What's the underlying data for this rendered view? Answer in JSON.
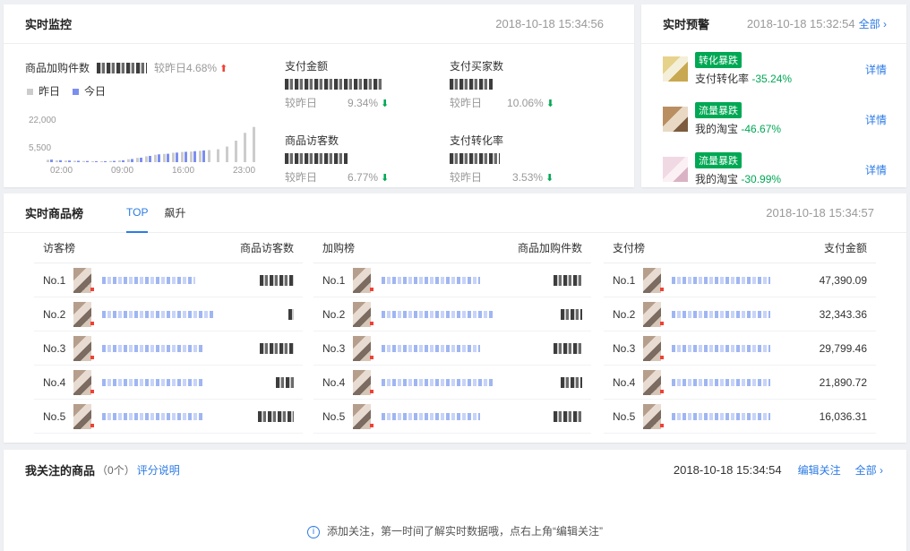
{
  "monitor": {
    "title": "实时监控",
    "time": "2018-10-18 15:34:56",
    "cart_label": "商品加购件数",
    "cart_cmp": "较昨日4.68%",
    "legend_yesterday": "昨日",
    "legend_today": "今日",
    "y_ticks": [
      "22,000",
      "5,500"
    ],
    "x_ticks": [
      "02:00",
      "09:00",
      "16:00",
      "23:00"
    ],
    "metrics": [
      {
        "label": "支付金额",
        "cmp_label": "较昨日",
        "cmp": "9.34%"
      },
      {
        "label": "支付买家数",
        "cmp_label": "较昨日",
        "cmp": "10.06%"
      },
      {
        "label": "商品访客数",
        "cmp_label": "较昨日",
        "cmp": "6.77%"
      },
      {
        "label": "支付转化率",
        "cmp_label": "较昨日",
        "cmp": "3.53%"
      }
    ],
    "colors": {
      "yesterday": "#cccccc",
      "today": "#7b8ef0"
    }
  },
  "chart_data": {
    "type": "bar",
    "categories": [
      "02:00",
      "09:00",
      "16:00",
      "23:00"
    ],
    "series": [
      {
        "name": "昨日",
        "values": [
          1200,
          900,
          800,
          700,
          600,
          500,
          500,
          600,
          900,
          1500,
          2200,
          3000,
          3800,
          4200,
          4800,
          5200,
          5400,
          5800,
          6200,
          6600,
          8000,
          11000,
          15000,
          18000
        ]
      },
      {
        "name": "今日",
        "values": [
          1300,
          1000,
          850,
          700,
          600,
          520,
          520,
          650,
          950,
          1600,
          2300,
          3200,
          4000,
          4300,
          4900,
          5300,
          5600,
          6000
        ]
      }
    ],
    "ylim": [
      0,
      22000
    ]
  },
  "alerts": {
    "title": "实时预警",
    "time": "2018-10-18 15:32:54",
    "all_link": "全部",
    "items": [
      {
        "badge": "转化暴跌",
        "label": "支付转化率",
        "change": "-35.24%",
        "link": "详情"
      },
      {
        "badge": "流量暴跌",
        "label": "我的淘宝",
        "change": "-46.67%",
        "link": "详情"
      },
      {
        "badge": "流量暴跌",
        "label": "我的淘宝",
        "change": "-30.99%",
        "link": "详情"
      }
    ]
  },
  "ranking": {
    "title": "实时商品榜",
    "tabs": [
      "TOP",
      "飙升"
    ],
    "time": "2018-10-18 15:34:57",
    "columns": [
      {
        "title": "访客榜",
        "value_header": "商品访客数"
      },
      {
        "title": "加购榜",
        "value_header": "商品加购件数"
      },
      {
        "title": "支付榜",
        "value_header": "支付金额"
      }
    ],
    "ranks": [
      "No.1",
      "No.2",
      "No.3",
      "No.4",
      "No.5"
    ],
    "pay_values": [
      "47,390.09",
      "32,343.36",
      "29,799.46",
      "21,890.72",
      "16,036.31"
    ]
  },
  "follow": {
    "title": "我关注的商品",
    "count": "（0个）",
    "rating_link": "评分说明",
    "time": "2018-10-18 15:34:54",
    "edit_link": "编辑关注",
    "all_link": "全部",
    "empty_hint": "添加关注，第一时间了解实时数据哦，点右上角“编辑关注”"
  }
}
